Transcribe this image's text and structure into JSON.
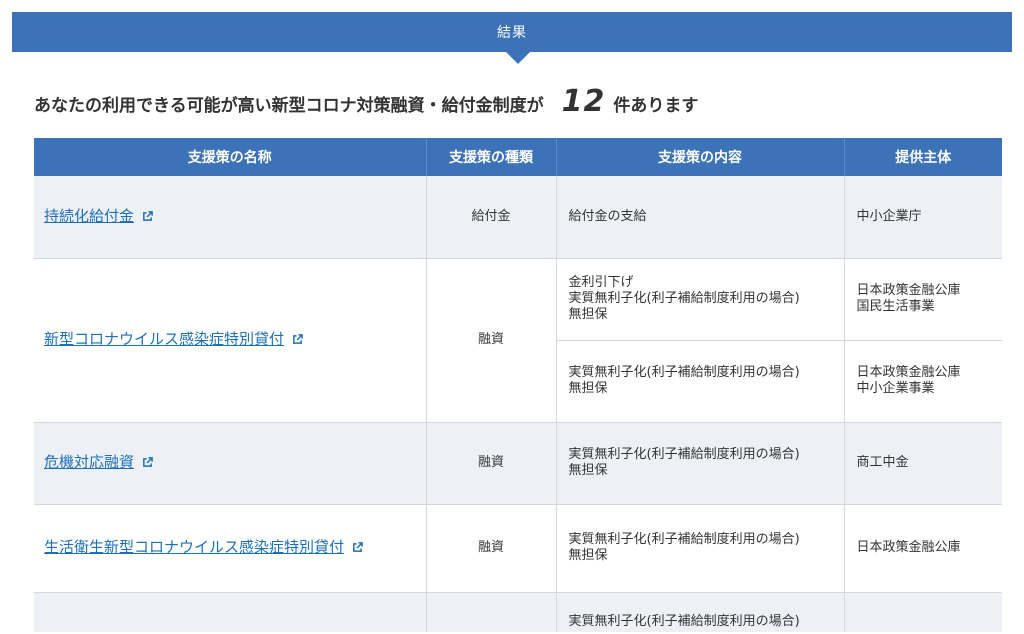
{
  "banner": {
    "title": "結果"
  },
  "summary": {
    "prefix": "あなたの利用できる可能が高い新型コロナ対策融資・給付金制度が",
    "count": "12",
    "suffix": "件あります"
  },
  "table": {
    "headers": [
      "支援策の名称",
      "支援策の種類",
      "支援策の内容",
      "提供主体"
    ],
    "rows": [
      {
        "name": "持続化給付金",
        "type": "給付金",
        "items": [
          {
            "content": [
              "給付金の支給"
            ],
            "provider": [
              "中小企業庁"
            ]
          }
        ]
      },
      {
        "name": "新型コロナウイルス感染症特別貸付",
        "type": "融資",
        "items": [
          {
            "content": [
              "金利引下げ",
              "実質無利子化(利子補給制度利用の場合)",
              "無担保"
            ],
            "provider": [
              "日本政策金融公庫",
              "国民生活事業"
            ]
          },
          {
            "content": [
              "実質無利子化(利子補給制度利用の場合)",
              "無担保"
            ],
            "provider": [
              "日本政策金融公庫",
              "中小企業事業"
            ]
          }
        ]
      },
      {
        "name": "危機対応融資",
        "type": "融資",
        "items": [
          {
            "content": [
              "実質無利子化(利子補給制度利用の場合)",
              "無担保"
            ],
            "provider": [
              "商工中金"
            ]
          }
        ]
      },
      {
        "name": "生活衛生新型コロナウイルス感染症特別貸付",
        "type": "融資",
        "items": [
          {
            "content": [
              "実質無利子化(利子補給制度利用の場合)",
              "無担保"
            ],
            "provider": [
              "日本政策金融公庫"
            ]
          }
        ]
      },
      {
        "name": "",
        "type": "",
        "items": [
          {
            "content": [
              "実質無利子化(利子補給制度利用の場合)"
            ],
            "provider": []
          }
        ]
      }
    ]
  },
  "icons": {
    "external_link": "external-link-icon"
  },
  "colors": {
    "accent": "#3b72b8",
    "link": "#1d6fb8",
    "row_alt": "#edf1f6"
  }
}
